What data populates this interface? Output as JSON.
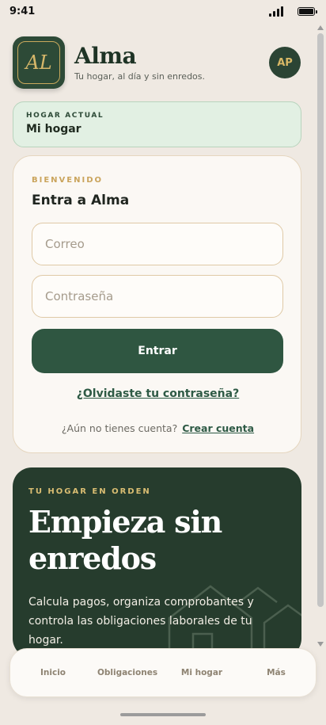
{
  "status_bar": {
    "time": "9:41",
    "signal_icon": "cellular-signal-icon",
    "battery_icon": "battery-icon",
    "battery_level": 1.0
  },
  "header": {
    "logo_monogram": "AL",
    "app_name": "Alma",
    "tagline": "Tu hogar, al día y sin enredos.",
    "avatar_initials": "AP"
  },
  "household": {
    "label": "HOGAR ACTUAL",
    "value": "Mi hogar"
  },
  "login": {
    "eyebrow": "BIENVENIDO",
    "title": "Entra a Alma",
    "email_placeholder": "Correo",
    "email_value": "",
    "password_placeholder": "Contraseña",
    "password_value": "",
    "submit_label": "Entrar",
    "forgot_label": "¿Olvidaste tu contraseña?",
    "signup_prompt": "¿Aún no tienes cuenta?",
    "signup_link": "Crear cuenta"
  },
  "promo": {
    "eyebrow": "TU HOGAR EN ORDEN",
    "title": "Empieza sin enredos",
    "description": "Calcula pagos, organiza comprobantes y controla las obligaciones laborales de tu hogar.",
    "art_icon": "houses-illustration-icon"
  },
  "bottom_nav": {
    "items": [
      {
        "label": "Inicio"
      },
      {
        "label": "Obligaciones"
      },
      {
        "label": "Mi hogar"
      },
      {
        "label": "Más"
      }
    ]
  },
  "colors": {
    "background": "#efe9e2",
    "brand_green": "#2f5641",
    "dark_green": "#263c2d",
    "gold": "#caa45c",
    "household_bg": "#e2f0e3"
  }
}
